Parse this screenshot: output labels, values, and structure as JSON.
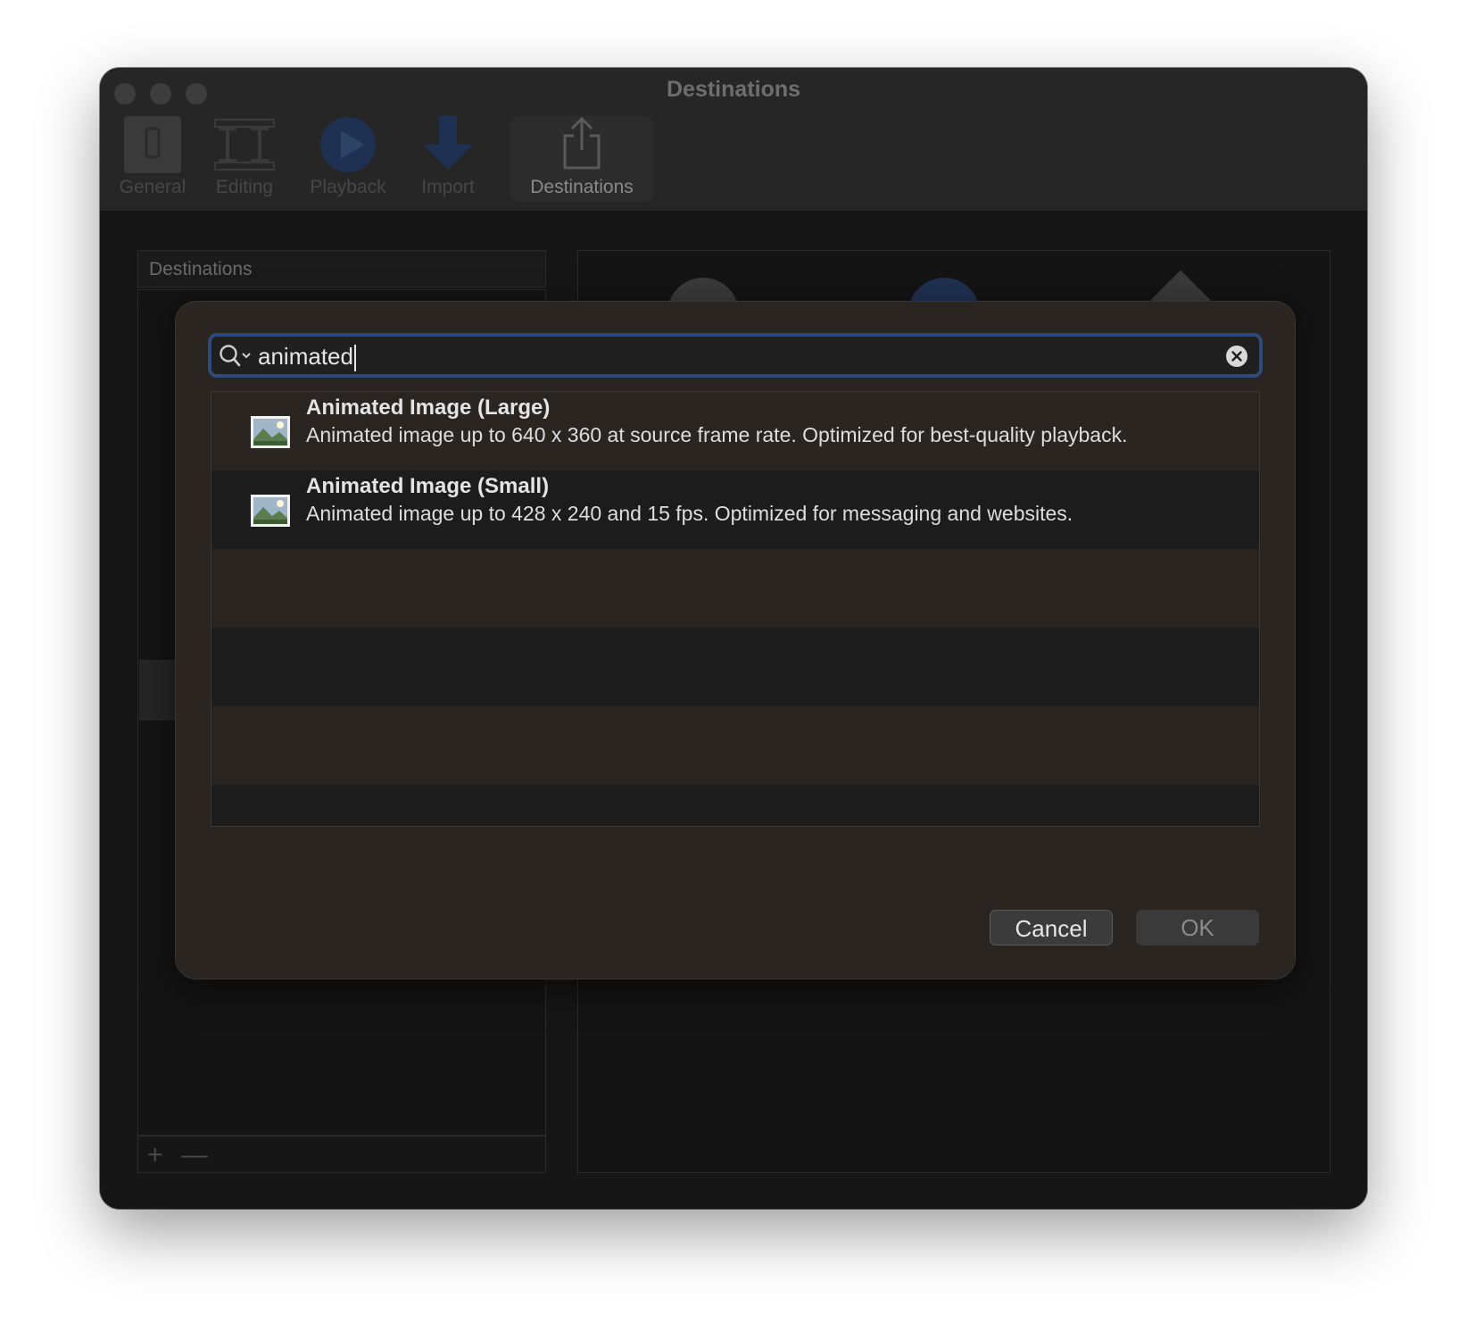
{
  "window": {
    "title": "Destinations"
  },
  "toolbar": {
    "items": [
      {
        "label": "General",
        "icon": "phone-icon",
        "selected": false
      },
      {
        "label": "Editing",
        "icon": "film-strip-icon",
        "selected": false
      },
      {
        "label": "Playback",
        "icon": "play-icon",
        "selected": false
      },
      {
        "label": "Import",
        "icon": "down-arrow-icon",
        "selected": false
      },
      {
        "label": "Destinations",
        "icon": "share-icon",
        "selected": true
      }
    ]
  },
  "sidebar": {
    "header": "Destinations",
    "footer": {
      "add_label": "+",
      "remove_label": "—"
    }
  },
  "dialog": {
    "search": {
      "value": "animated",
      "icon": "search-icon",
      "clear_icon": "clear-icon"
    },
    "results": [
      {
        "title": "Animated Image (Large)",
        "description": "Animated image up to 640 x 360 at source frame rate. Optimized for best-quality playback.",
        "icon": "image-icon"
      },
      {
        "title": "Animated Image (Small)",
        "description": "Animated image up to 428 x 240 and 15 fps. Optimized for messaging and websites.",
        "icon": "image-icon"
      }
    ],
    "cancel_label": "Cancel",
    "ok_label": "OK"
  },
  "colors": {
    "accent": "#2d4a78",
    "dialog_bg": "#2a2521"
  }
}
